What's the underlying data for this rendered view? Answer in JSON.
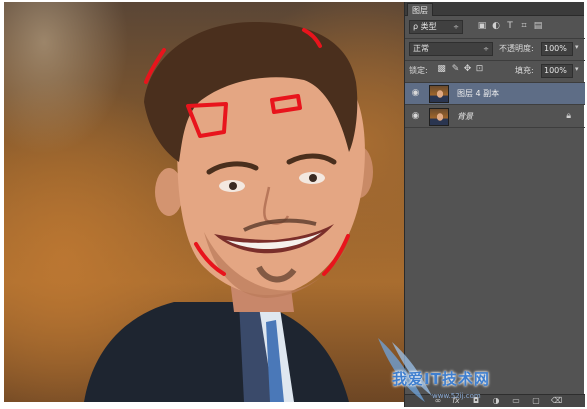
{
  "panel": {
    "tab_title": "图层",
    "filter": {
      "label": "ρ 类型",
      "chevron": "÷"
    },
    "filter_icons": [
      "image-filter-icon",
      "adjustment-filter-icon",
      "type-filter-icon",
      "shape-filter-icon",
      "smartobject-filter-icon"
    ],
    "blend_mode": "正常",
    "opacity_label": "不透明度:",
    "opacity_value": "100%",
    "lock_label": "锁定:",
    "lock_icons": [
      "lock-transparent-icon",
      "lock-paint-icon",
      "lock-position-icon",
      "lock-all-icon"
    ],
    "fill_label": "填充:",
    "fill_value": "100%",
    "layers": [
      {
        "name": "图层 4 副本",
        "visible": true,
        "selected": true,
        "locked": false
      },
      {
        "name": "背景",
        "visible": true,
        "selected": false,
        "locked": true
      }
    ],
    "bottom_icons": [
      "link-layers-icon",
      "fx-icon",
      "add-mask-icon",
      "adjustment-layer-icon",
      "new-group-icon",
      "new-layer-icon",
      "delete-layer-icon"
    ],
    "fx_label": "fx"
  },
  "watermark": {
    "text": "我爱IT技术网",
    "url": "www.52ij.com"
  },
  "colors": {
    "panel_bg": "#535353",
    "selected_layer": "#5e6d86",
    "annotation_red": "#e8141c"
  }
}
